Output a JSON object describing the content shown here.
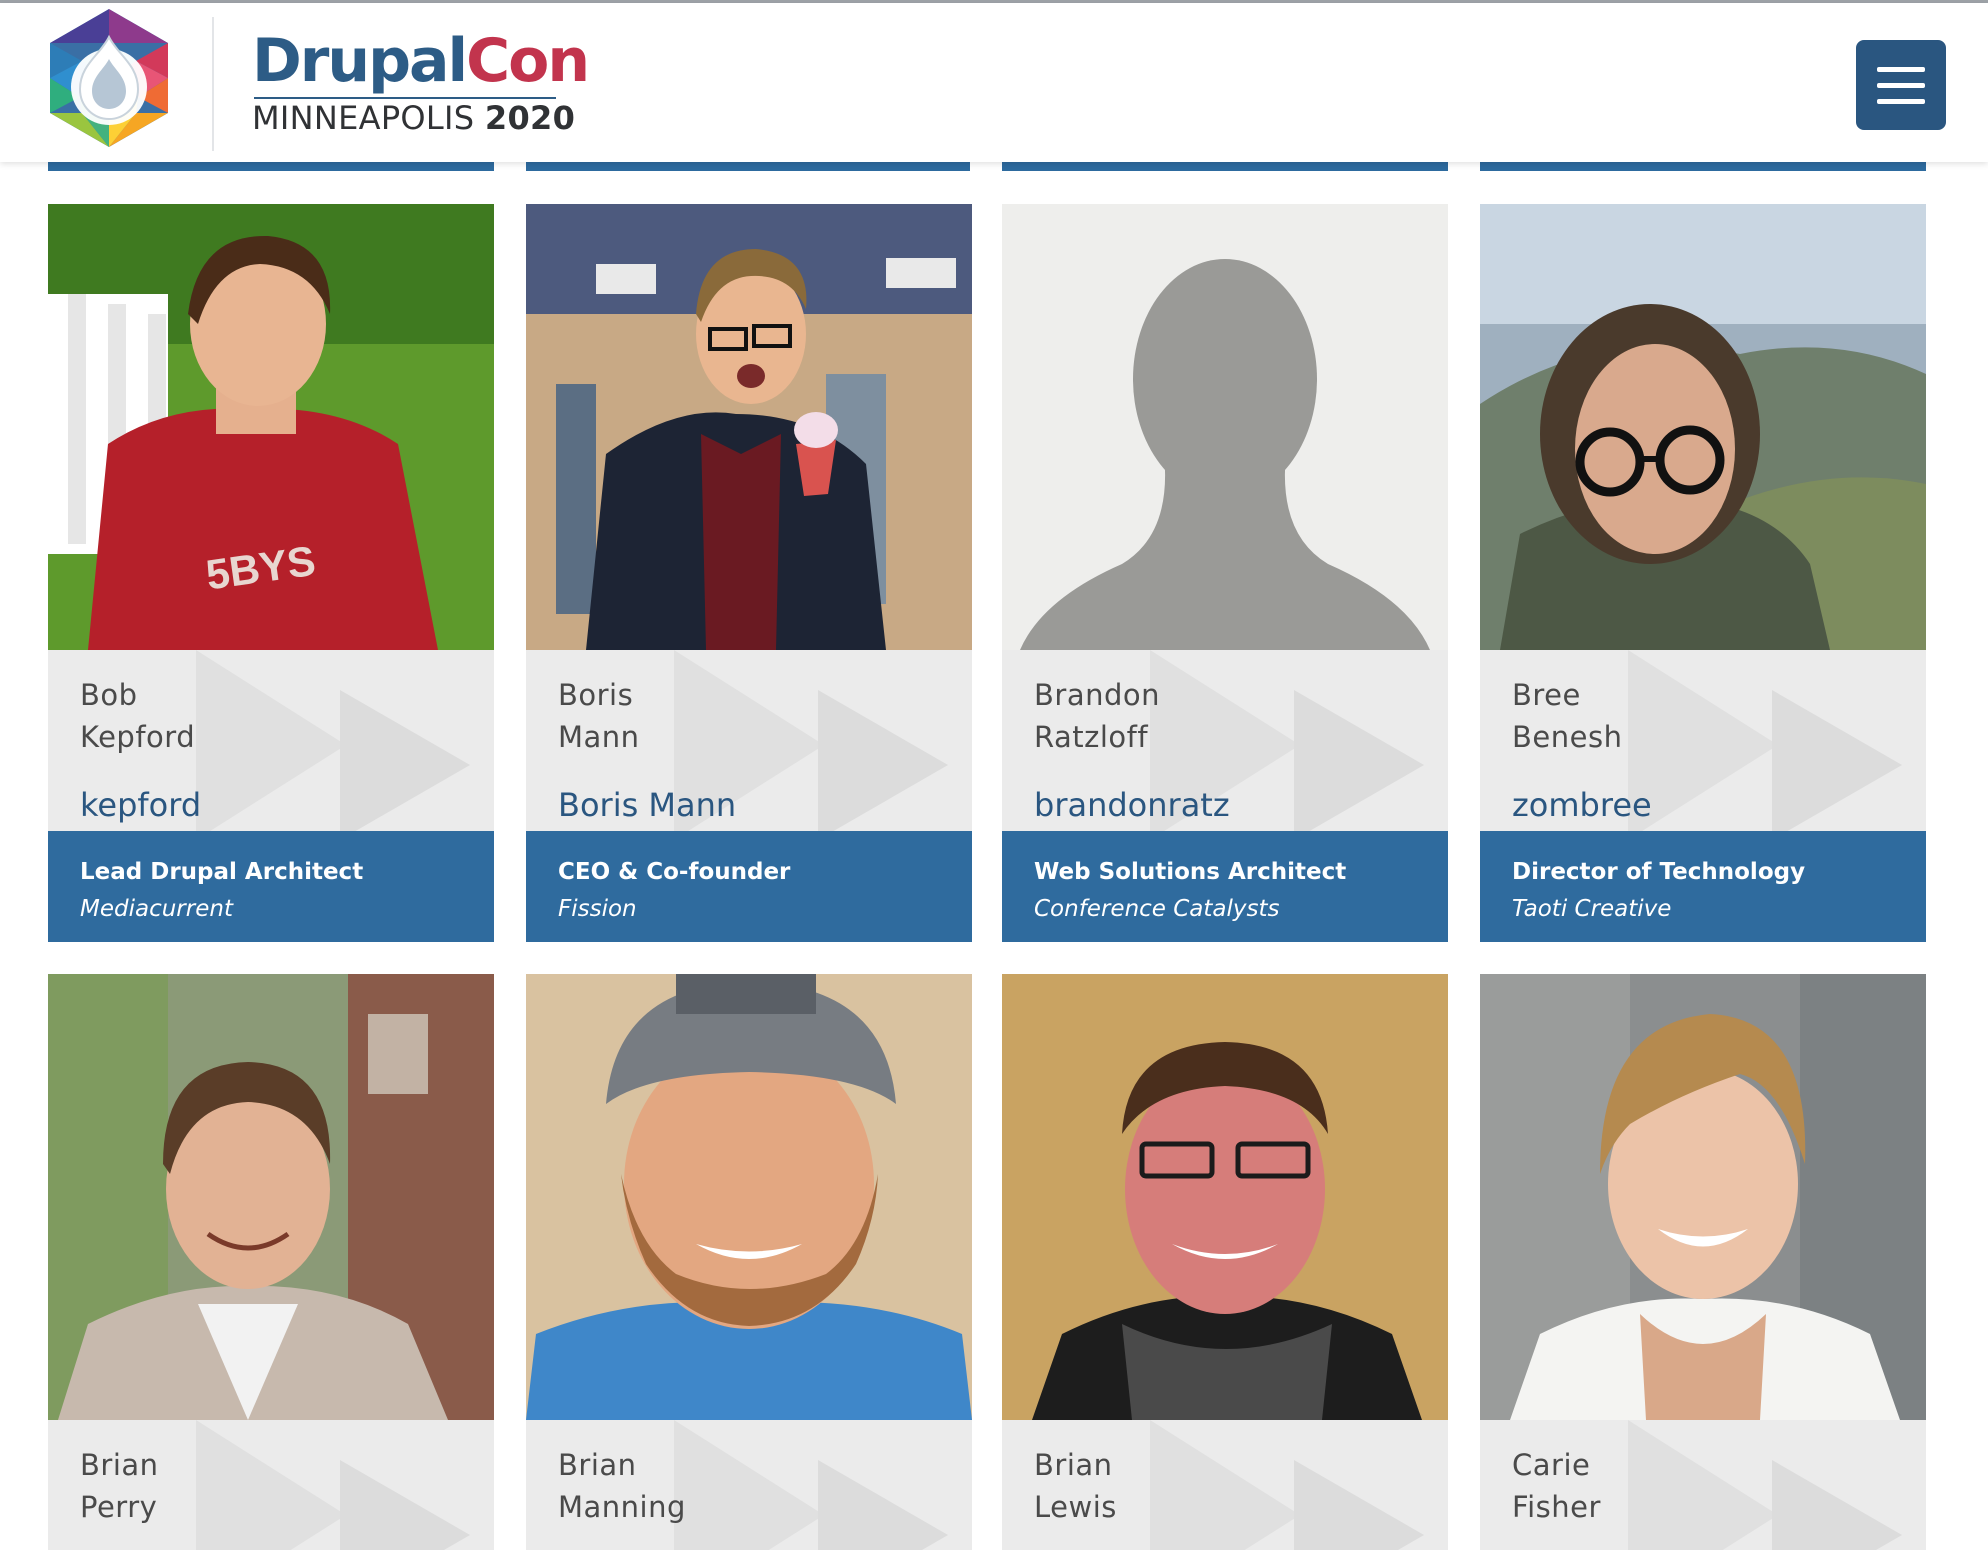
{
  "header": {
    "brand_primary": "Drupal",
    "brand_secondary": "Con",
    "city": "MINNEAPOLIS",
    "year": "2020",
    "menu_label": "Menu"
  },
  "colors": {
    "brand_blue": "#2d5c86",
    "brand_red": "#c2344d",
    "bar_blue": "#2f6b9e",
    "name_bg": "#ebebeb"
  },
  "speakers": [
    {
      "first": "Bob",
      "last": "Kepford",
      "handle": "kepford",
      "title": "Lead Drupal Architect",
      "org": "Mediacurrent",
      "photo_icon": "person-photo"
    },
    {
      "first": "Boris",
      "last": "Mann",
      "handle": "Boris Mann",
      "title": "CEO & Co-founder",
      "org": "Fission",
      "photo_icon": "person-photo"
    },
    {
      "first": "Brandon",
      "last": "Ratzloff",
      "handle": "brandonratz",
      "title": "Web Solutions Architect",
      "org": "Conference Catalysts",
      "photo_icon": "default-avatar-icon"
    },
    {
      "first": "Bree",
      "last": "Benesh",
      "handle": "zombree",
      "title": "Director of Technology",
      "org": "Taoti Creative",
      "photo_icon": "person-photo"
    },
    {
      "first": "Brian",
      "last": "Perry",
      "photo_icon": "person-photo"
    },
    {
      "first": "Brian",
      "last": "Manning",
      "photo_icon": "person-photo"
    },
    {
      "first": "Brian",
      "last": "Lewis",
      "photo_icon": "person-photo"
    },
    {
      "first": "Carie",
      "last": "Fisher",
      "photo_icon": "person-photo"
    }
  ]
}
